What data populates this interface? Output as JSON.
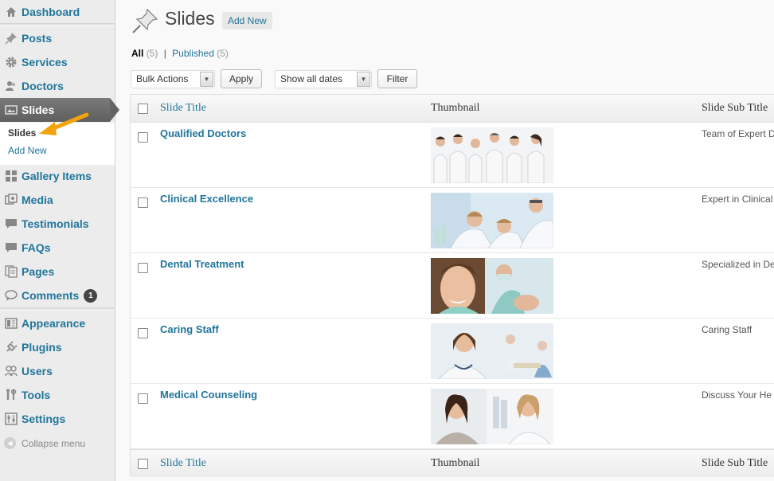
{
  "sidebar": {
    "dashboard": "Dashboard",
    "items1": [
      {
        "label": "Posts",
        "icon": "pin-icon"
      },
      {
        "label": "Services",
        "icon": "gear-icon"
      },
      {
        "label": "Doctors",
        "icon": "users-icon"
      }
    ],
    "active": {
      "label": "Slides",
      "icon": "slides-icon"
    },
    "submenu": {
      "current": "Slides",
      "add_new": "Add New"
    },
    "items2": [
      {
        "label": "Gallery Items",
        "icon": "grid-icon"
      },
      {
        "label": "Media",
        "icon": "media-icon"
      },
      {
        "label": "Testimonials",
        "icon": "comment-icon"
      },
      {
        "label": "FAQs",
        "icon": "comment-icon"
      },
      {
        "label": "Pages",
        "icon": "pages-icon"
      },
      {
        "label": "Comments",
        "icon": "comments-icon",
        "badge": "1"
      }
    ],
    "items3": [
      {
        "label": "Appearance",
        "icon": "appearance-icon"
      },
      {
        "label": "Plugins",
        "icon": "plugin-icon"
      },
      {
        "label": "Users",
        "icon": "users-icon"
      },
      {
        "label": "Tools",
        "icon": "tools-icon"
      },
      {
        "label": "Settings",
        "icon": "settings-icon"
      }
    ],
    "collapse": "Collapse menu"
  },
  "header": {
    "title": "Slides",
    "add_new": "Add New"
  },
  "filters": {
    "all_label": "All",
    "all_count": "(5)",
    "separator": "|",
    "published_label": "Published",
    "published_count": "(5)",
    "bulk_actions": "Bulk Actions",
    "apply": "Apply",
    "dates": "Show all dates",
    "filter": "Filter"
  },
  "table": {
    "columns": [
      "Slide Title",
      "Thumbnail",
      "Slide Sub Title"
    ],
    "rows": [
      {
        "title": "Qualified Doctors",
        "subtitle": "Team of Expert D",
        "thumb": "doctors-group-thumbnail"
      },
      {
        "title": "Clinical Excellence",
        "subtitle": "Expert in Clinical",
        "thumb": "lab-thumbnail"
      },
      {
        "title": "Dental Treatment",
        "subtitle": "Specialized in De",
        "thumb": "dental-thumbnail"
      },
      {
        "title": "Caring Staff",
        "subtitle": "Caring Staff",
        "thumb": "nurse-thumbnail"
      },
      {
        "title": "Medical Counseling",
        "subtitle": "Discuss Your He",
        "thumb": "counseling-thumbnail"
      }
    ]
  },
  "colors": {
    "link": "#21759b",
    "active_menu": "#646464",
    "annotation_arrow": "#f0a30a"
  }
}
